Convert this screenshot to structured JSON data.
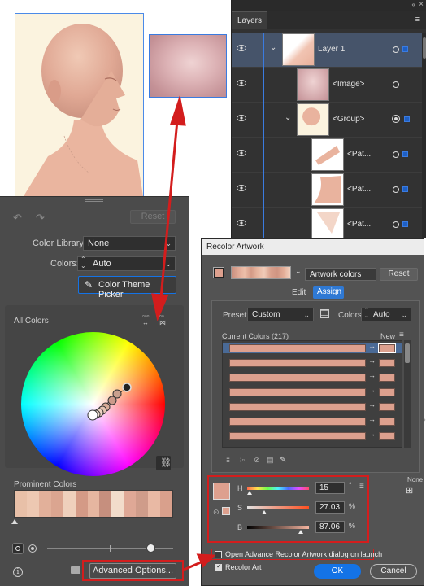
{
  "layers_panel": {
    "tab_label": "Layers",
    "rows": [
      {
        "name": "Layer 1"
      },
      {
        "name": "<Image>"
      },
      {
        "name": "<Group>"
      },
      {
        "name": "<Pat..."
      },
      {
        "name": "<Pat..."
      },
      {
        "name": "<Pat..."
      }
    ]
  },
  "left_panel": {
    "reset_label": "Reset",
    "color_library_label": "Color Library:",
    "color_library_value": "None",
    "colors_label": "Colors:",
    "colors_value": "Auto",
    "color_theme_picker_label": "Color Theme Picker",
    "all_colors_label": "All Colors",
    "prominent_colors_label": "Prominent Colors",
    "advanced_options_label": "Advanced Options...",
    "prominent_swatches": [
      "#e8c0a8",
      "#edc8b2",
      "#e2b09a",
      "#dba590",
      "#efd0bc",
      "#d49a86",
      "#e6b6a0",
      "#c68f7e",
      "#f2dccb",
      "#dfa896",
      "#cf9c8a",
      "#e9b9a4",
      "#d9a08c"
    ]
  },
  "recolor_dialog": {
    "title": "Recolor Artwork",
    "artwork_colors_value": "Artwork colors",
    "reset_label": "Reset",
    "tabs": {
      "edit": "Edit",
      "assign": "Assign"
    },
    "preset_label": "Preset:",
    "preset_value": "Custom",
    "colors_label": "Colors:",
    "colors_value": "Auto",
    "current_colors_label": "Current Colors (217)",
    "new_label": "New",
    "none_label": "None",
    "swatch_color": "#dda08e",
    "h_label": "H",
    "h_value": "15",
    "h_unit": "°",
    "s_label": "S",
    "s_value": "27.03",
    "s_unit": "%",
    "b_label": "B",
    "b_value": "87.06",
    "b_unit": "%",
    "h_level": 0.04,
    "s_level": 0.27,
    "b_level": 0.87,
    "open_advanced_label": "Open Advance Recolor Artwork dialog on launch",
    "recolor_art_label": "Recolor Art",
    "ok_label": "OK",
    "cancel_label": "Cancel"
  },
  "colors": {
    "accent_blue": "#1473e6",
    "annotation_red": "#d31d1d",
    "skin": "#dda08e"
  }
}
